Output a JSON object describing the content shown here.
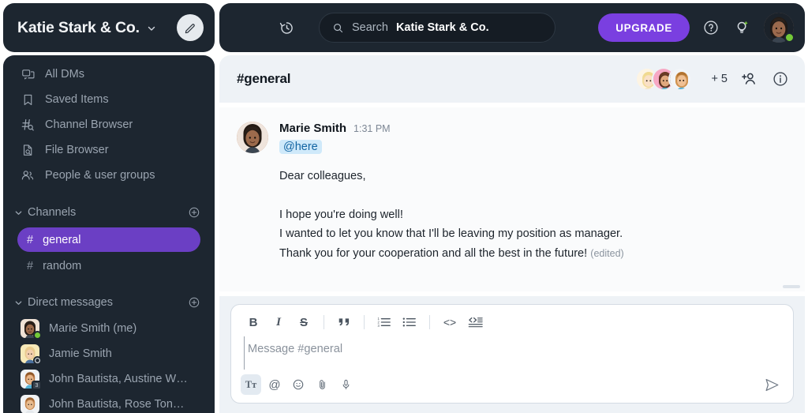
{
  "workspace": {
    "name": "Katie Stark & Co.",
    "chevron_icon": "chevron-down-icon",
    "compose_icon": "pencil-icon"
  },
  "topbar": {
    "history_icon": "history-clock-icon",
    "search": {
      "icon": "search-icon",
      "label": "Search",
      "value": "Katie Stark & Co."
    },
    "upgrade_label": "UPGRADE",
    "help_icon": "question-circle-icon",
    "ideas_icon": "lightbulb-icon",
    "avatar_name": "user-avatar",
    "status": "online",
    "status_color": "#74c938",
    "accent_color": "#7a3fe0",
    "background_color": "#1d2630"
  },
  "sidebar": {
    "nav_items": [
      {
        "label": "All DMs",
        "icon": "chat-bubbles-icon"
      },
      {
        "label": "Saved Items",
        "icon": "bookmark-icon"
      },
      {
        "label": "Channel Browser",
        "icon": "hash-search-icon"
      },
      {
        "label": "File Browser",
        "icon": "file-search-icon"
      },
      {
        "label": "People & user groups",
        "icon": "people-icon"
      }
    ],
    "channels_section": {
      "label": "Channels",
      "caret_icon": "chevron-down-icon",
      "add_icon": "plus-circle-icon",
      "items": [
        {
          "label": "general",
          "hash": "#",
          "active": true
        },
        {
          "label": "random",
          "hash": "#",
          "active": false
        }
      ]
    },
    "dms_section": {
      "label": "Direct messages",
      "caret_icon": "chevron-down-icon",
      "add_icon": "plus-circle-icon",
      "items": [
        {
          "label": "Marie Smith (me)",
          "badge": "online",
          "badge_text": ""
        },
        {
          "label": "Jamie Smith",
          "badge": "away",
          "badge_text": ""
        },
        {
          "label": "John Bautista, Austine W…",
          "badge": "count",
          "badge_text": "3"
        },
        {
          "label": "John Bautista, Rose Ton…",
          "badge": "none",
          "badge_text": ""
        }
      ]
    },
    "active_color": "#6b3fc4"
  },
  "channel": {
    "title": "#general",
    "member_overflow": "+ 5",
    "add_member_icon": "add-person-icon",
    "info_icon": "info-circle-icon"
  },
  "message": {
    "author": "Marie Smith",
    "time": "1:31 PM",
    "mention": "@here",
    "lines": [
      "Dear colleagues,",
      "",
      "I hope you're doing well!",
      "I wanted to let you know that I'll be leaving my position as manager."
    ],
    "last_line": "Thank you for your cooperation and all the best in the future!",
    "edited_label": "(edited)"
  },
  "composer": {
    "placeholder": "Message #general",
    "format_buttons": [
      {
        "label": "B",
        "name": "bold-icon"
      },
      {
        "label": "I",
        "name": "italic-icon"
      },
      {
        "label": "S",
        "name": "strikethrough-icon"
      },
      {
        "label": "”",
        "name": "quote-icon"
      },
      {
        "label": "",
        "name": "ordered-list-icon"
      },
      {
        "label": "",
        "name": "bullet-list-icon"
      },
      {
        "label": "<>",
        "name": "code-icon"
      },
      {
        "label": "",
        "name": "code-block-icon"
      }
    ],
    "foot_buttons": [
      {
        "name": "text-format-icon",
        "label": "Tᴛ",
        "active": true
      },
      {
        "name": "mention-icon",
        "label": "@",
        "active": false
      },
      {
        "name": "emoji-icon",
        "label": "",
        "active": false
      },
      {
        "name": "attachment-icon",
        "label": "",
        "active": false
      },
      {
        "name": "microphone-icon",
        "label": "",
        "active": false
      }
    ],
    "send_icon": "send-arrow-icon"
  }
}
